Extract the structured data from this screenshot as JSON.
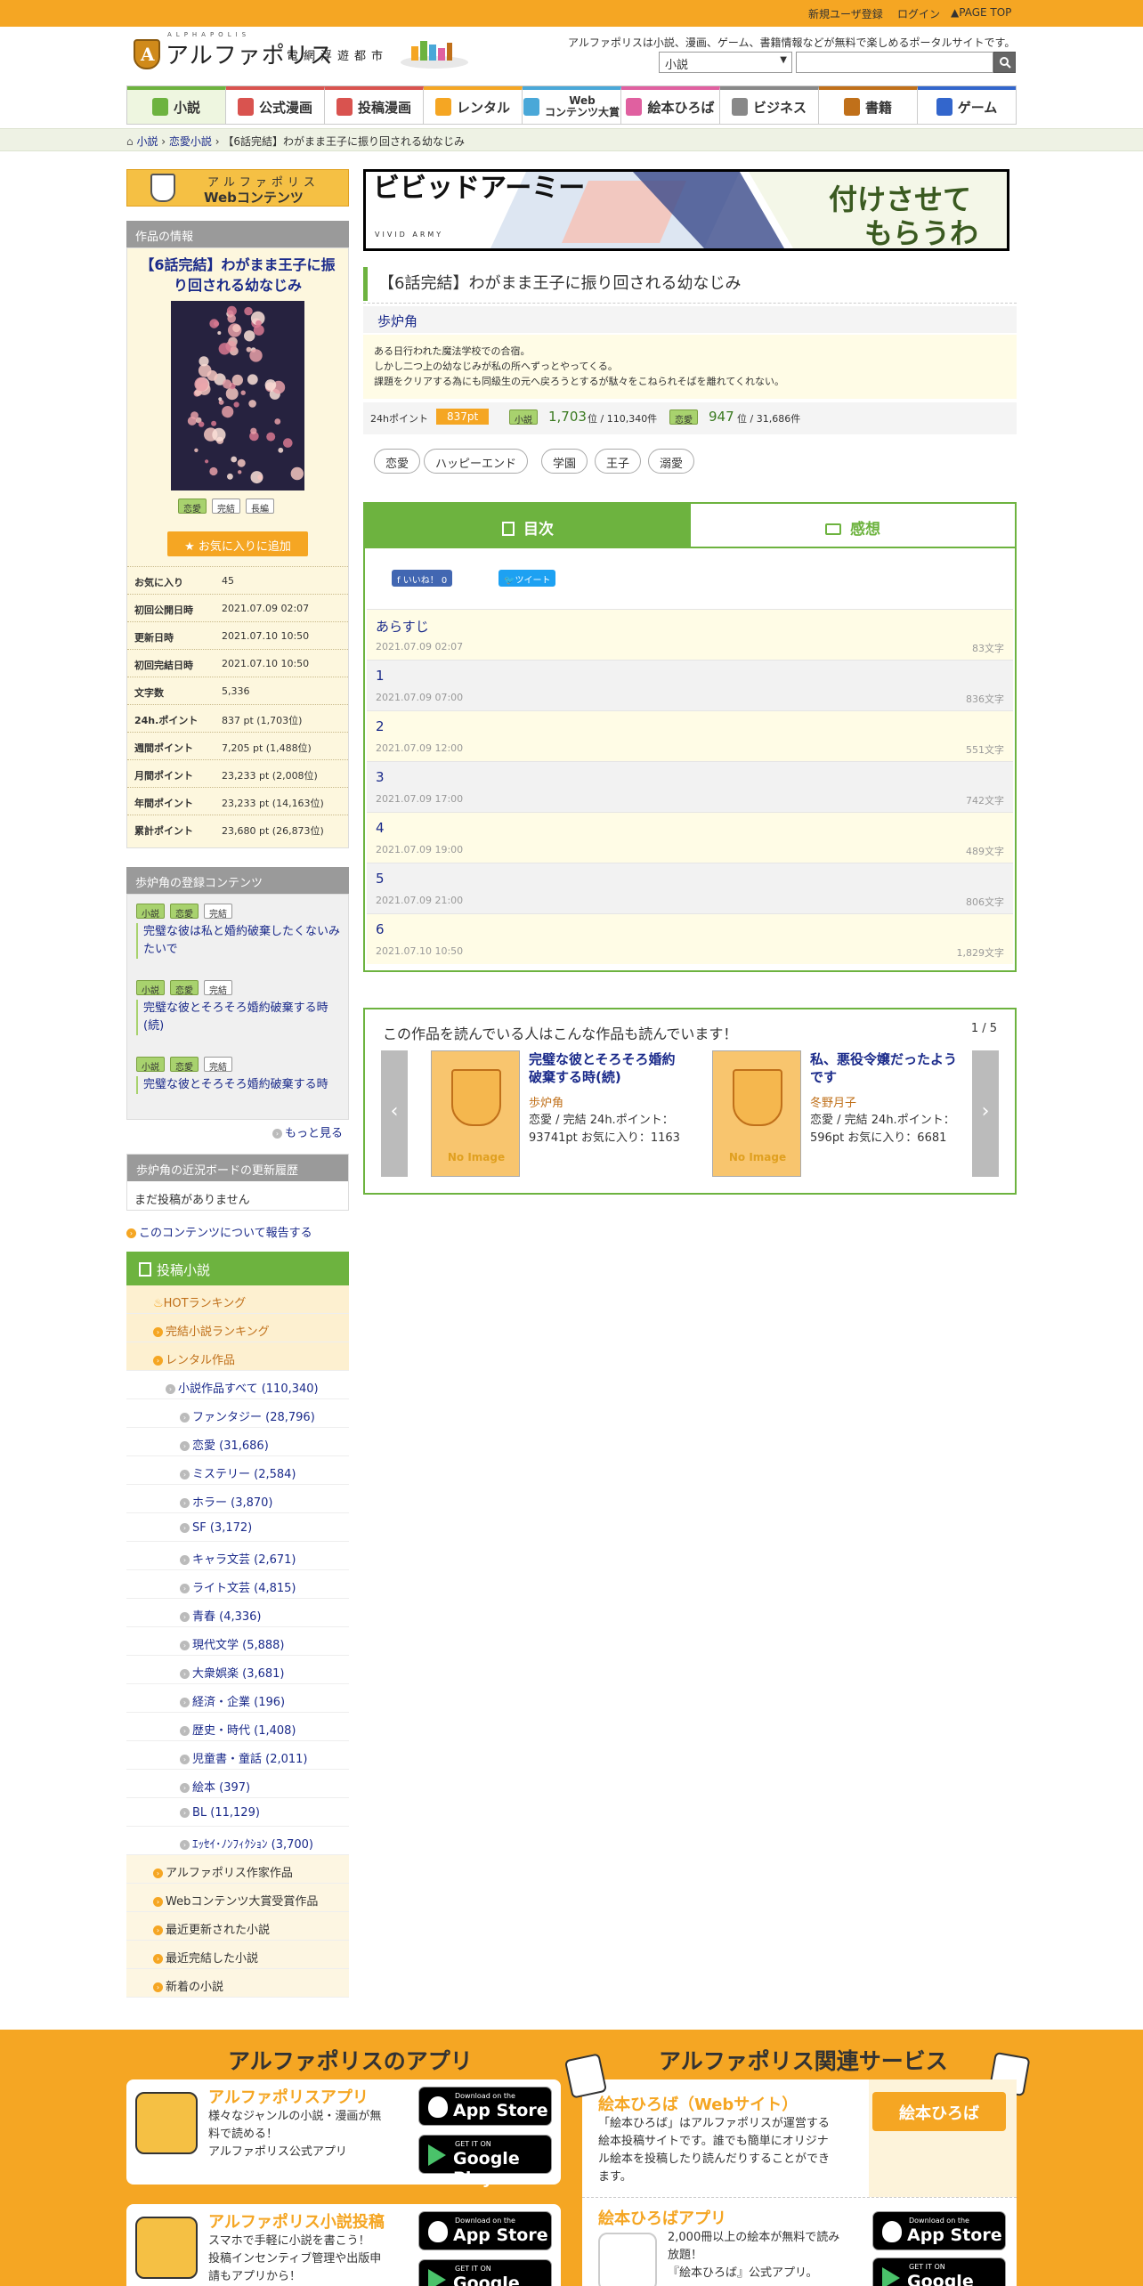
{
  "topbar": {
    "register": "新規ユーザ登録",
    "login": "ログイン",
    "page_top": "PAGE TOP"
  },
  "header": {
    "logo_text": "アルファポリス",
    "logo_sub": "電網浮遊都市",
    "logo_kana": "ALPHAPOLIS",
    "tagline": "アルファポリスは小説、漫画、ゲーム、書籍情報などが無料で楽しめるポータルサイトです。",
    "search_category": "小説",
    "search_placeholder": ""
  },
  "nav": [
    {
      "label": "小説",
      "color": "#6db33f",
      "active": true
    },
    {
      "label": "公式漫画",
      "color": "#d9534f"
    },
    {
      "label": "投稿漫画",
      "color": "#d9534f"
    },
    {
      "label": "レンタル",
      "color": "#f5a623"
    },
    {
      "label": "Web\nコンテンツ大賞",
      "color": "#4aa8d8"
    },
    {
      "label": "絵本ひろば",
      "color": "#e060a0"
    },
    {
      "label": "ビジネス",
      "color": "#888888"
    },
    {
      "label": "書籍",
      "color": "#c0701a"
    },
    {
      "label": "ゲーム",
      "color": "#3366cc"
    }
  ],
  "breadcrumb": {
    "home_icon": "home-icon",
    "items": [
      "小説",
      "恋愛小説",
      "【6話完結】わがまま王子に振り回される幼なじみ"
    ]
  },
  "sidebar": {
    "webcontents": {
      "line1": "アルファポリス",
      "line2": "Webコンテンツ"
    },
    "info_header": "作品の情報",
    "work_title": "【6話完結】わがまま王子に振り回される幼なじみ",
    "badges": [
      "恋愛",
      "完結",
      "長編"
    ],
    "fav_button": "お気に入りに追加",
    "stats": [
      {
        "k": "お気に入り",
        "v": "45"
      },
      {
        "k": "初回公開日時",
        "v": "2021.07.09 02:07"
      },
      {
        "k": "更新日時",
        "v": "2021.07.10 10:50"
      },
      {
        "k": "初回完結日時",
        "v": "2021.07.10 10:50"
      },
      {
        "k": "文字数",
        "v": "5,336"
      },
      {
        "k": "24h.ポイント",
        "v": "837 pt (1,703位)"
      },
      {
        "k": "週間ポイント",
        "v": "7,205 pt (1,488位)"
      },
      {
        "k": "月間ポイント",
        "v": "23,233 pt (2,008位)"
      },
      {
        "k": "年間ポイント",
        "v": "23,233 pt (14,163位)"
      },
      {
        "k": "累計ポイント",
        "v": "23,680 pt (26,873位)"
      }
    ],
    "author_header": "歩炉角の登録コンテンツ",
    "author_contents": [
      {
        "tags": [
          "小説",
          "恋愛",
          "完結"
        ],
        "title": "完璧な彼は私と婚約破棄したくないみたいで"
      },
      {
        "tags": [
          "小説",
          "恋愛",
          "完結"
        ],
        "title": "完璧な彼とそろそろ婚約破棄する時(続)"
      },
      {
        "tags": [
          "小説",
          "恋愛",
          "完結"
        ],
        "title": "完璧な彼とそろそろ婚約破棄する時"
      }
    ],
    "more": "もっと見る",
    "board_header": "歩炉角の近況ボードの更新履歴",
    "board_empty": "まだ投稿がありません",
    "report": "このコンテンツについて報告する",
    "menu_header": "投稿小説",
    "menu": [
      {
        "label": "HOTランキング",
        "lv": "lv1"
      },
      {
        "label": "完結小説ランキング",
        "lv": "lv1"
      },
      {
        "label": "レンタル作品",
        "lv": "lv1"
      },
      {
        "label": "小説作品すべて (110,340)",
        "lv": "lv2"
      },
      {
        "label": "ファンタジー (28,796)",
        "lv": "lv3"
      },
      {
        "label": "恋愛 (31,686)",
        "lv": "lv3"
      },
      {
        "label": "ミステリー (2,584)",
        "lv": "lv3"
      },
      {
        "label": "ホラー (3,870)",
        "lv": "lv3"
      },
      {
        "label": "SF (3,172)",
        "lv": "lv3"
      },
      {
        "label": "キャラ文芸 (2,671)",
        "lv": "lv3"
      },
      {
        "label": "ライト文芸 (4,815)",
        "lv": "lv3"
      },
      {
        "label": "青春 (4,336)",
        "lv": "lv3"
      },
      {
        "label": "現代文学 (5,888)",
        "lv": "lv3"
      },
      {
        "label": "大衆娯楽 (3,681)",
        "lv": "lv3"
      },
      {
        "label": "経済・企業 (196)",
        "lv": "lv3"
      },
      {
        "label": "歴史・時代 (1,408)",
        "lv": "lv3"
      },
      {
        "label": "児童書・童話 (2,011)",
        "lv": "lv3"
      },
      {
        "label": "絵本 (397)",
        "lv": "lv3"
      },
      {
        "label": "BL (11,129)",
        "lv": "lv3"
      },
      {
        "label": "ｴｯｾｲ･ﾉﾝﾌｨｸｼｮﾝ (3,700)",
        "lv": "lv3"
      },
      {
        "label": "アルファポリス作家作品",
        "lv": "lv1b"
      },
      {
        "label": "Webコンテンツ大賞受賞作品",
        "lv": "lv1b"
      },
      {
        "label": "最近更新された小説",
        "lv": "lv1b"
      },
      {
        "label": "最近完結した小説",
        "lv": "lv1b"
      },
      {
        "label": "新着の小説",
        "lv": "lv1b"
      }
    ]
  },
  "ad": {
    "brand": "ビビッドアーミー",
    "brand_en": "VIVID ARMY",
    "line1": "付けさせて",
    "line2": "もらうわよ!"
  },
  "main": {
    "title": "【6話完結】わがまま王子に振り回される幼なじみ",
    "author": "歩炉角",
    "synopsis": [
      "ある日行われた魔法学校での合宿。",
      "しかし二つ上の幼なじみが私の所へずっとやってくる。",
      "課題をクリアする為にも同級生の元へ戻ろうとするが駄々をこねられそばを離れてくれない。"
    ],
    "points_label": "24hポイント",
    "points_value": "837pt",
    "rank1_tag": "小説",
    "rank1_value": "1,703",
    "rank1_rest": "位 / 110,340件",
    "rank2_tag": "恋愛",
    "rank2_value": "947",
    "rank2_rest": "位 / 31,686件",
    "tags": [
      "恋愛",
      "ハッピーエンド",
      "学園",
      "王子",
      "溺愛"
    ],
    "tab_toc": "目次",
    "tab_comments": "感想",
    "like_button": "いいね！ 0",
    "tweet_button": "ツイート",
    "episodes": [
      {
        "name": "あらすじ",
        "date": "2021.07.09 02:07",
        "chars": "83文字"
      },
      {
        "name": "1",
        "date": "2021.07.09 07:00",
        "chars": "836文字"
      },
      {
        "name": "2",
        "date": "2021.07.09 12:00",
        "chars": "551文字"
      },
      {
        "name": "3",
        "date": "2021.07.09 17:00",
        "chars": "742文字"
      },
      {
        "name": "4",
        "date": "2021.07.09 19:00",
        "chars": "489文字"
      },
      {
        "name": "5",
        "date": "2021.07.09 21:00",
        "chars": "806文字"
      },
      {
        "name": "6",
        "date": "2021.07.10 10:50",
        "chars": "1,829文字"
      }
    ],
    "reco_header": "この作品を読んでいる人はこんな作品も読んでいます！",
    "reco_pager": "1 / 5",
    "reco_no_image": "No Image",
    "reco": [
      {
        "title": "完璧な彼とそろそろ婚約破棄する時(続)",
        "author": "歩炉角",
        "meta": "恋愛 / 完結 24h.ポイント：93741pt お気に入り：1163"
      },
      {
        "title": "私、悪役令嬢だったようです",
        "author": "冬野月子",
        "meta": "恋愛 / 完結 24h.ポイント：596pt お気に入り：6681"
      }
    ]
  },
  "footer": {
    "apps_header": "アルファポリスのアプリ",
    "services_header": "アルファポリス関連サービス",
    "app1_title": "アルファポリスアプリ",
    "app1_desc": [
      "様々なジャンルの小説・漫画が無",
      "料で読める！",
      "アルファポリス公式アプリ"
    ],
    "app2_title": "アルファポリス小説投稿",
    "app2_desc": [
      "スマホで手軽に小説を書こう！",
      "投稿インセンティブ管理や出版申",
      "請もアプリから！"
    ],
    "svc1_title": "絵本ひろば（Webサイト）",
    "svc1_desc": [
      "「絵本ひろば」はアルファポリスが運営する",
      "絵本投稿サイトです。誰でも簡単にオリジナ",
      "ル絵本を投稿したり読んだりすることができ",
      "ます。"
    ],
    "svc1_button": "絵本ひろば",
    "svc2_title": "絵本ひろばアプリ",
    "svc2_desc": [
      "2,000冊以上の絵本が無料で読み",
      "放題！",
      "『絵本ひろば』公式アプリ。"
    ],
    "appstore_small": "Download on the",
    "appstore_big": "App Store",
    "gplay_small": "GET IT ON",
    "gplay_big": "Google Play"
  }
}
